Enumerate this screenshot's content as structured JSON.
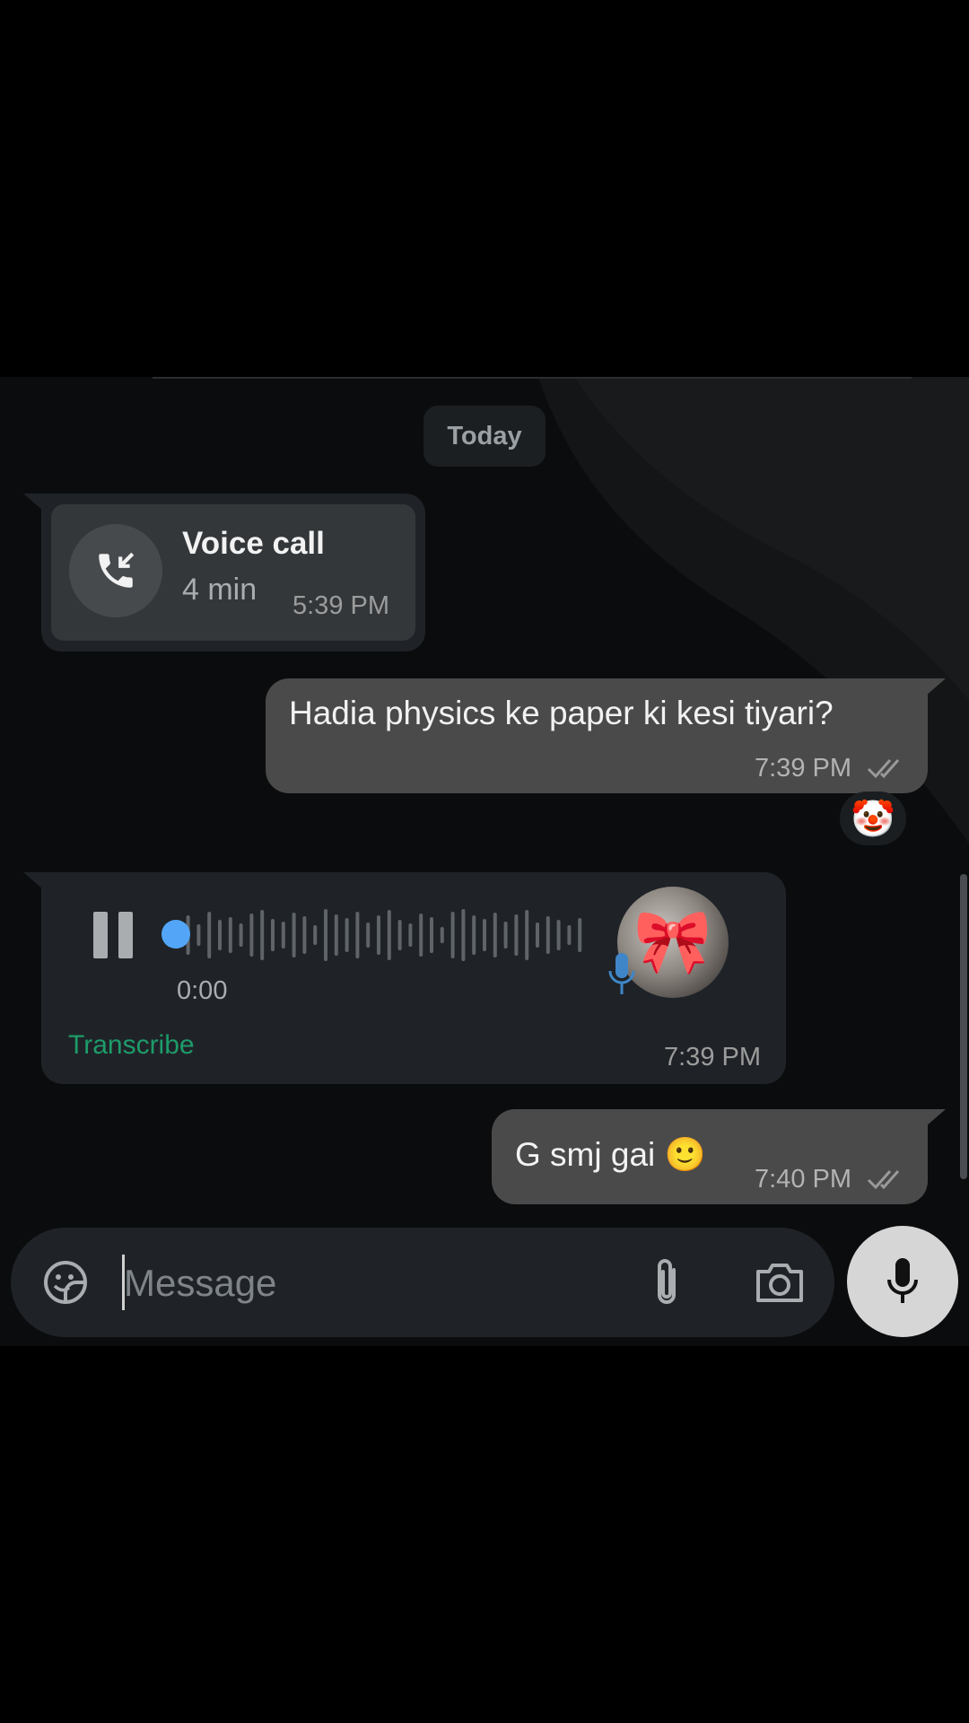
{
  "date_separator": "Today",
  "messages": [
    {
      "type": "call",
      "direction": "in",
      "title": "Voice call",
      "duration": "4 min",
      "time": "5:39 PM"
    },
    {
      "type": "text",
      "direction": "out",
      "text": "Hadia physics ke paper ki kesi tiyari?",
      "time": "7:39 PM",
      "status": "read",
      "reaction": "🤡"
    },
    {
      "type": "voice",
      "direction": "in",
      "duration": "0:00",
      "transcribe_label": "Transcribe",
      "time": "7:39 PM",
      "avatar_emoji": "🎀",
      "progress": 0
    },
    {
      "type": "text",
      "direction": "out",
      "text": "G smj gai 🙂",
      "time": "7:40 PM",
      "status": "read"
    }
  ],
  "composer": {
    "placeholder": "Message",
    "icons": [
      "sticker-icon",
      "attach-icon",
      "camera-icon",
      "mic-icon"
    ]
  },
  "colors": {
    "incoming_bubble": "#1f2327",
    "outgoing_bubble": "#4a4a4a",
    "accent_green": "#1e9b6a",
    "voice_dot": "#53a6f7"
  }
}
